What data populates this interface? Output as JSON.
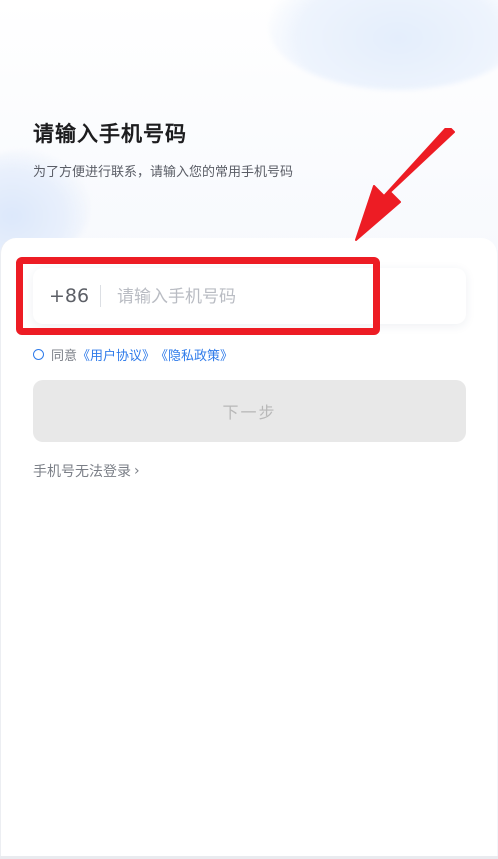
{
  "header": {
    "title": "请输入手机号码",
    "subtitle": "为了方便进行联系，请输入您的常用手机号码"
  },
  "phone": {
    "country_code": "+86",
    "placeholder": "请输入手机号码",
    "value": ""
  },
  "agreement": {
    "prefix": "同意",
    "user_agreement": "《用户协议》",
    "privacy_policy": "《隐私政策》",
    "checked": false
  },
  "next_button": {
    "label": "下一步",
    "enabled": false
  },
  "cannot_login": {
    "label": "手机号无法登录",
    "chevron": "›"
  },
  "colors": {
    "accent": "#2f7bea",
    "highlight": "#ed1c24",
    "button_disabled_bg": "#e8e8e8"
  },
  "icons": {
    "arrow": "red-pointer-arrow-icon",
    "chevron": "chevron-right-icon",
    "radio": "radio-unchecked-icon"
  }
}
